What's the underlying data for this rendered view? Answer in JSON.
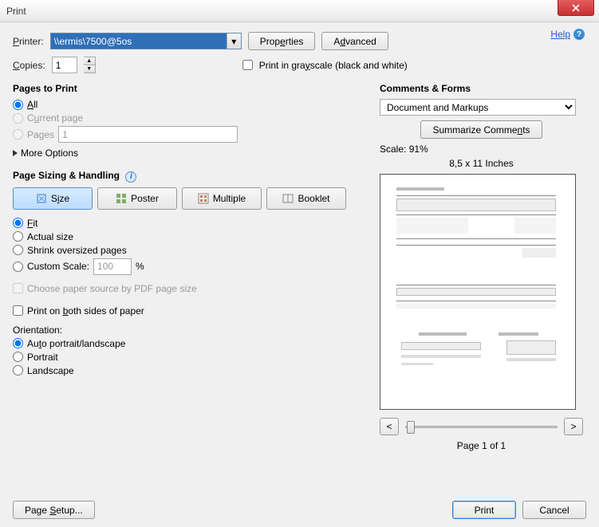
{
  "window": {
    "title": "Print"
  },
  "help": {
    "label": "Help"
  },
  "top": {
    "printer_label": "Printer:",
    "printer_value": "\\\\ermis\\7500@5os",
    "properties_btn": "Properties",
    "advanced_btn": "Advanced",
    "copies_label": "Copies:",
    "copies_value": "1",
    "grayscale_label": "Print in grayscale (black and white)"
  },
  "pages": {
    "title": "Pages to Print",
    "all": "All",
    "current": "Current page",
    "pages_label": "Pages",
    "pages_value": "1",
    "more": "More Options"
  },
  "sizing": {
    "title": "Page Sizing & Handling",
    "size": "Size",
    "poster": "Poster",
    "multiple": "Multiple",
    "booklet": "Booklet",
    "fit": "Fit",
    "actual": "Actual size",
    "shrink": "Shrink oversized pages",
    "custom_label": "Custom Scale:",
    "custom_value": "100",
    "custom_pct": "%",
    "choose_paper": "Choose paper source by PDF page size",
    "both_sides": "Print on both sides of paper",
    "orientation_label": "Orientation:",
    "auto": "Auto portrait/landscape",
    "portrait": "Portrait",
    "landscape": "Landscape"
  },
  "comments": {
    "title": "Comments & Forms",
    "value": "Document and Markups",
    "summarize": "Summarize Comments"
  },
  "preview": {
    "scale_label": "Scale:",
    "scale_value": "91%",
    "dimensions": "8,5 x 11 Inches",
    "page_of": "Page 1 of 1",
    "prev": "<",
    "next": ">"
  },
  "bottom": {
    "page_setup": "Page Setup...",
    "print": "Print",
    "cancel": "Cancel"
  }
}
